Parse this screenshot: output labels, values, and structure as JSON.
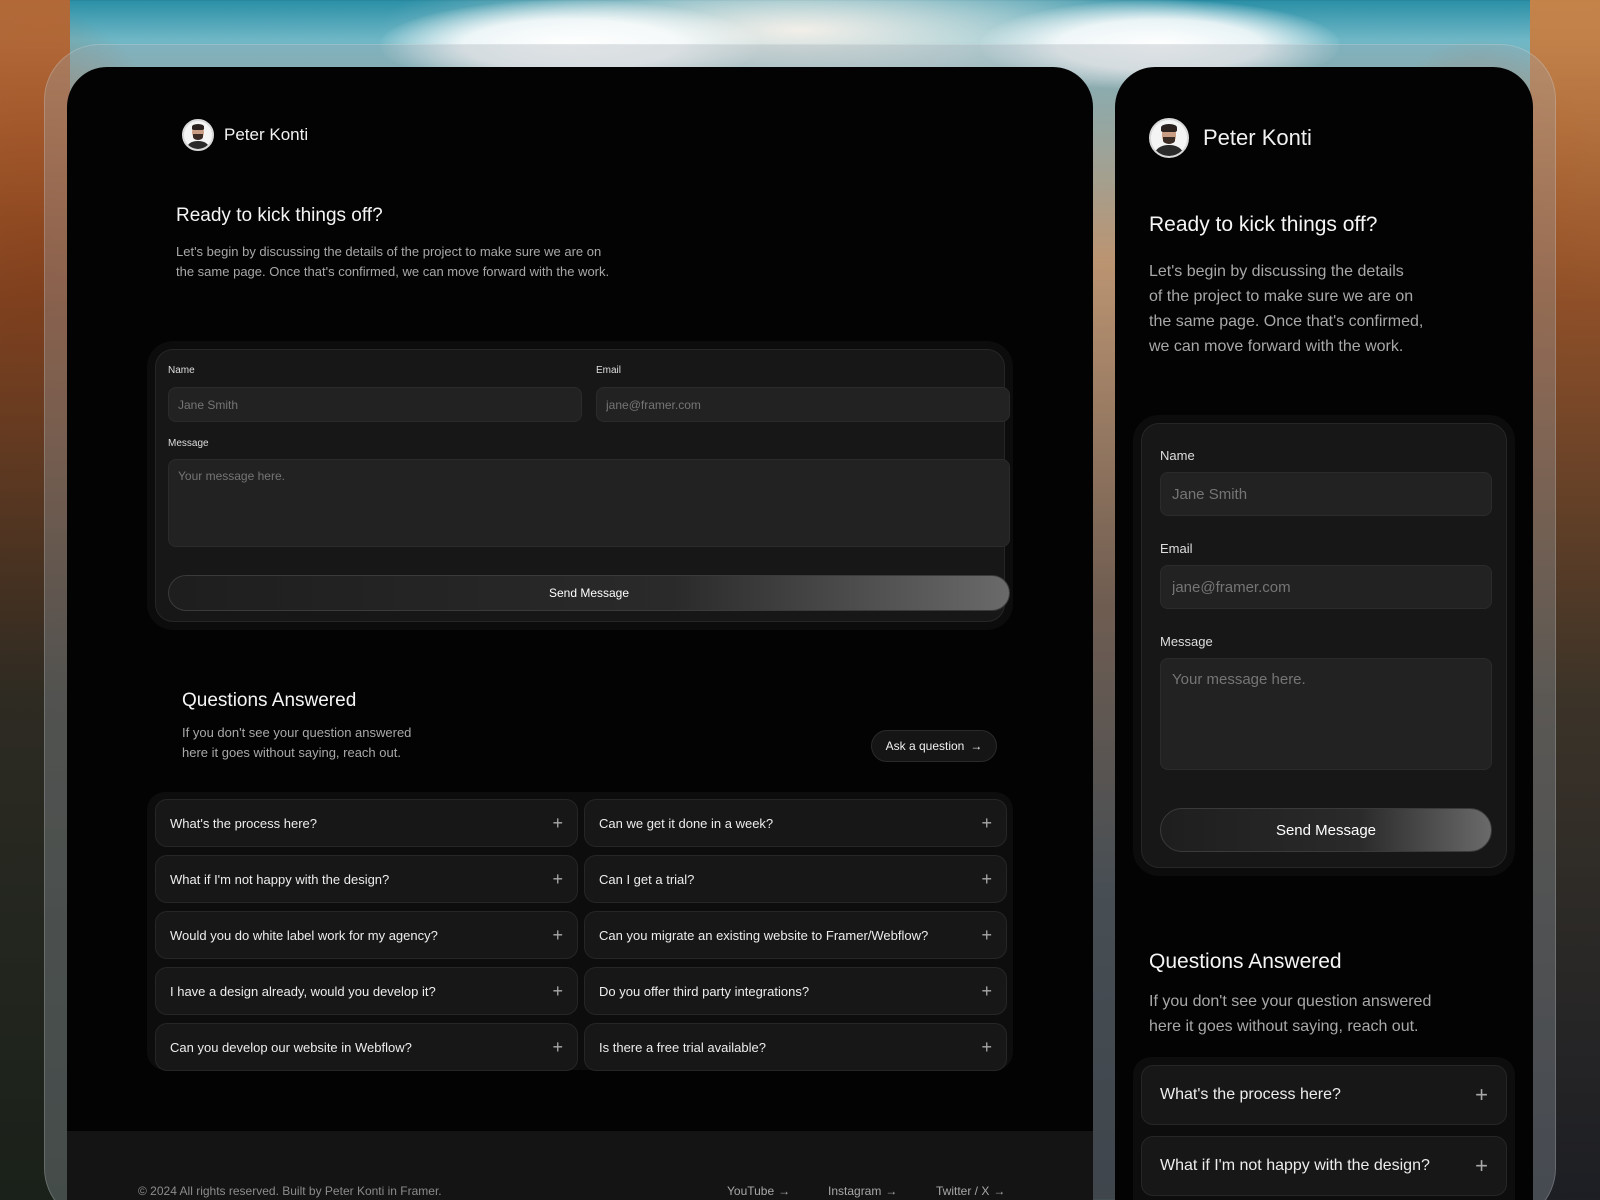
{
  "brand": {
    "name": "Peter Konti"
  },
  "intro": {
    "title": "Ready to kick things off?",
    "body_desktop_line1": "Let's begin by discussing the details of the project to make sure we are on",
    "body_desktop_line2": "the same page. Once that's confirmed, we can move forward with the work.",
    "body_mobile_line1": "Let's begin by discussing the details",
    "body_mobile_line2": "of the project to make sure we are on",
    "body_mobile_line3": "the same page. Once that's confirmed,",
    "body_mobile_line4": "we can move forward with the work."
  },
  "form": {
    "name_label": "Name",
    "name_placeholder": "Jane Smith",
    "email_label": "Email",
    "email_placeholder": "jane@framer.com",
    "message_label": "Message",
    "message_placeholder": "Your message here.",
    "submit_label": "Send Message"
  },
  "faq": {
    "title": "Questions Answered",
    "subtitle_line1": "If you don't see your question answered",
    "subtitle_line2": "here it goes without saying, reach out.",
    "ask_label": "Ask a question",
    "questions": [
      "What's the process here?",
      "Can we get it done in a week?",
      "What if I'm not happy with the design?",
      "Can I get a trial?",
      "Would you do white label work for my agency?",
      "Can you migrate an existing website to Framer/Webflow?",
      "I have a design already, would you develop it?",
      "Do you offer third party integrations?",
      "Can you develop our website in Webflow?",
      "Is there a free trial available?"
    ]
  },
  "footer": {
    "copyright": "© 2024 All rights reserved. Built by Peter Konti in Framer.",
    "links": [
      "YouTube",
      "Instagram",
      "Twitter / X"
    ]
  },
  "icons": {
    "expand": "plus-icon",
    "link": "arrow-right-icon"
  },
  "colors": {
    "panel": "#030303",
    "card": "#171717",
    "input": "#222222",
    "muted_text": "#a8a8a8"
  }
}
